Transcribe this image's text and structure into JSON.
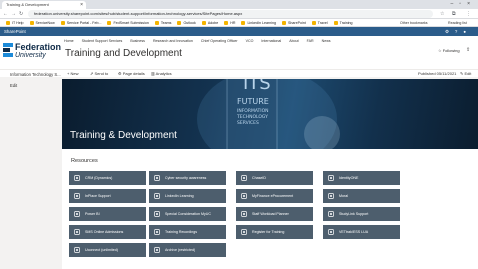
{
  "browser": {
    "tab_title": "Training & Development",
    "url": "federation.university.sharepoint.com/sites/hub/student-support/information-technology-services/SitePages/Home.aspx",
    "bookmarks": [
      "IT Help",
      "ServiceNow",
      "Service Portal - Feb...",
      "FedSmart Submission",
      "Teams",
      "Outlook",
      "Adobe",
      "HR",
      "LinkedIn Learning",
      "SharePoint",
      "Travel",
      "Training"
    ],
    "bookmarks_right": [
      "Other bookmarks",
      "Reading list"
    ]
  },
  "suitebar": {
    "app": "SharePoint"
  },
  "site": {
    "logo_line1": "Federation",
    "logo_line2": "University",
    "topnav": [
      "Home",
      "Student Support Services",
      "Business",
      "Research and Innovation",
      "Chief Operating Officer",
      "VCO",
      "International",
      "About",
      "FAR",
      "News"
    ],
    "title": "Training and Development",
    "follow": "Following",
    "share": "Share site"
  },
  "commandbar": {
    "new": "New",
    "send": "Send to",
    "details": "Page details",
    "analytics": "Analytics",
    "published": "Published 05/11/2021",
    "edit": "Edit"
  },
  "leftnav": {
    "header": "Information Technology S...",
    "edit": "Edit"
  },
  "hero": {
    "title": "Training & Development",
    "bg_words": [
      "ITS",
      "FUTURE",
      "INFORMATION",
      "TECHNOLOGY",
      "SERVICES"
    ]
  },
  "resources": {
    "heading": "Resources",
    "tiles": [
      {
        "label": "CRM (Dynamics)",
        "icon": "crm-icon"
      },
      {
        "label": "Cyber security awareness",
        "icon": "lock-icon"
      },
      {
        "label": "ChaseID",
        "icon": "id-icon"
      },
      {
        "label": "IdentityONE",
        "icon": "user-icon"
      },
      {
        "label": "InPlace Support",
        "icon": "support-icon"
      },
      {
        "label": "LinkedIn Learning",
        "icon": "linkedin-icon"
      },
      {
        "label": "MyFinance eProcurement",
        "icon": "finance-icon"
      },
      {
        "label": "Moral",
        "icon": "info-icon"
      },
      {
        "label": "Power BI",
        "icon": "chart-icon"
      },
      {
        "label": "Special Consideration MyUC",
        "icon": "star-icon"
      },
      {
        "label": "Staff Workload Planner",
        "icon": "calendar-icon"
      },
      {
        "label": "StudyLink Support",
        "icon": "help-icon"
      },
      {
        "label": "SMS Online Admissions",
        "icon": "doc-icon"
      },
      {
        "label": "Training Recordings",
        "icon": "video-icon"
      },
      {
        "label": "Register for Training",
        "icon": "pencil-icon"
      },
      {
        "label": "VETtrak/ESS LUA",
        "icon": "globe-icon"
      },
      {
        "label": "Uconnect (unlimited)",
        "icon": "link-icon"
      },
      {
        "label": "Archive (restricted)",
        "icon": "archive-icon"
      }
    ]
  }
}
